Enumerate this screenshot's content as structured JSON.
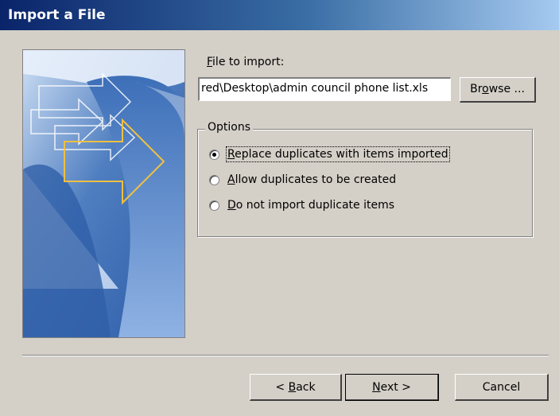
{
  "window": {
    "title": "Import a File"
  },
  "file_section": {
    "label_hotkey": "F",
    "label_rest": "ile to import:",
    "input_value": "red\\Desktop\\admin council phone list.xls",
    "browse_prefix": "Br",
    "browse_hotkey": "o",
    "browse_rest": "wse ..."
  },
  "options": {
    "legend": "Options",
    "items": [
      {
        "hotkey": "R",
        "rest": "eplace duplicates with items imported",
        "checked": true
      },
      {
        "hotkey": "A",
        "rest": "llow duplicates to be created",
        "checked": false
      },
      {
        "hotkey": "D",
        "rest": "o not import duplicate items",
        "checked": false
      }
    ]
  },
  "footer": {
    "back_prefix": "< ",
    "back_hotkey": "B",
    "back_rest": "ack",
    "next_hotkey": "N",
    "next_rest": "ext >",
    "cancel_label": "Cancel"
  },
  "icons": {
    "wizard_graphic": "import-arrows-graphic",
    "radio": "radio-button"
  },
  "colors": {
    "dialog_bg": "#d4d0c8",
    "title_gradient_start": "#0a246a",
    "title_gradient_end": "#a6caf0",
    "arrow_accent": "#f0c040"
  }
}
